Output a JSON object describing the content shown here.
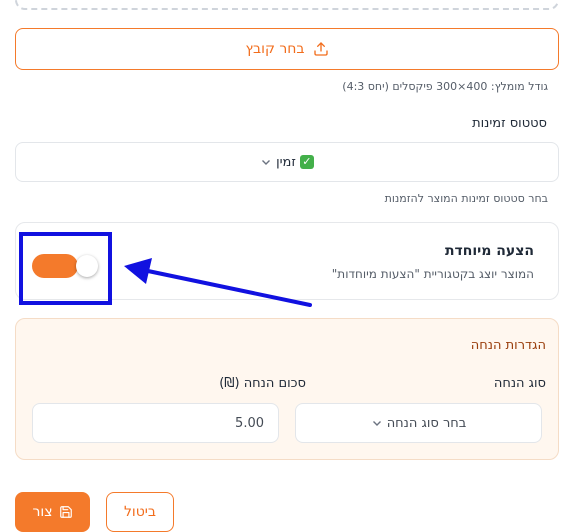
{
  "upload": {
    "button_label": "בחר קובץ",
    "size_hint": "גודל מומלץ: 400×300 פיקסלים (יחס 4:3)"
  },
  "availability": {
    "label": "סטטוס זמינות",
    "selected_value": "זמין",
    "helper": "בחר סטטוס זמינות המוצר להזמנות"
  },
  "featured": {
    "title": "הצעה מיוחדת",
    "description": "המוצר יוצג בקטגוריית \"הצעות מיוחדות\"",
    "enabled": true
  },
  "discount": {
    "section_title": "הגדרות הנחה",
    "type_label": "סוג הנחה",
    "type_placeholder": "בחר סוג הנחה",
    "amount_label": "סכום הנחה (₪)",
    "amount_value": "5.00"
  },
  "actions": {
    "save_label": "צור",
    "cancel_label": "ביטול"
  },
  "colors": {
    "accent": "#f47a2b",
    "annotation": "#1111e0"
  }
}
